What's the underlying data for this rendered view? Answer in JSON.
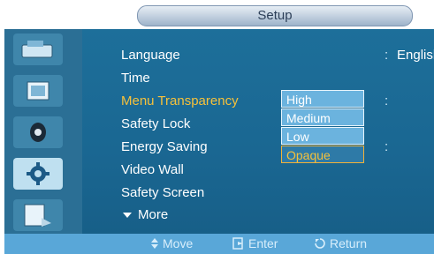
{
  "window": {
    "title": "Setup"
  },
  "menu": {
    "items": [
      {
        "label": "Language",
        "value": "English"
      },
      {
        "label": "Time",
        "value": ""
      },
      {
        "label": "Menu Transparency",
        "value": ""
      },
      {
        "label": "Safety Lock",
        "value": ""
      },
      {
        "label": "Energy Saving",
        "value": ""
      },
      {
        "label": "Video Wall",
        "value": ""
      },
      {
        "label": "Safety Screen",
        "value": ""
      }
    ],
    "more_label": "More"
  },
  "dropdown": {
    "options": [
      "High",
      "Medium",
      "Low",
      "Opaque"
    ],
    "selected": "Opaque"
  },
  "bottom_hints": [
    {
      "label": "Move",
      "icon": "updown-icon"
    },
    {
      "label": "Enter",
      "icon": "enter-icon"
    },
    {
      "label": "Return",
      "icon": "return-icon"
    }
  ],
  "sidebar": {
    "items": [
      {
        "icon": "picture-icon"
      },
      {
        "icon": "sound-icon"
      },
      {
        "icon": "speaker-icon"
      },
      {
        "icon": "setup-gear-icon"
      },
      {
        "icon": "input-icon"
      }
    ]
  },
  "colors": {
    "panel": "#1a6792",
    "selected_text": "#f6c13b",
    "bottom_bar": "#59a7d8"
  }
}
